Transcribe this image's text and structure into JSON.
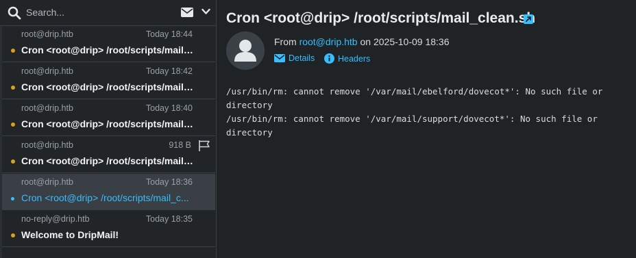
{
  "search": {
    "placeholder": "Search..."
  },
  "messages": [
    {
      "from": "root@drip.htb",
      "date": "Today 18:44",
      "subject": "Cron <root@drip> /root/scripts/mail_c..."
    },
    {
      "from": "root@drip.htb",
      "date": "Today 18:42",
      "subject": "Cron <root@drip> /root/scripts/mail_c..."
    },
    {
      "from": "root@drip.htb",
      "date": "Today 18:40",
      "subject": "Cron <root@drip> /root/scripts/mail_c..."
    },
    {
      "from": "root@drip.htb",
      "date": "918 B",
      "subject": "Cron <root@drip> /root/scripts/mail_c..."
    },
    {
      "from": "root@drip.htb",
      "date": "Today 18:36",
      "subject": "Cron <root@drip> /root/scripts/mail_c..."
    },
    {
      "from": "no-reply@drip.htb",
      "date": "Today 18:35",
      "subject": "Welcome to DripMail!"
    }
  ],
  "view": {
    "subject": "Cron <root@drip> /root/scripts/mail_clean.sh",
    "from_prefix": "From",
    "from_address": "root@drip.htb",
    "date_prefix": "on",
    "date": "2025-10-09 18:36",
    "details_label": "Details",
    "headers_label": "Headers",
    "body": "/usr/bin/rm: cannot remove '/var/mail/ebelford/dovecot*': No such file or\ndirectory\n/usr/bin/rm: cannot remove '/var/mail/support/dovecot*': No such file or\ndirectory"
  },
  "colors": {
    "accent": "#37beff",
    "unread_dot": "#d6a11e",
    "background": "#1f2326",
    "selected_row": "#393f44"
  },
  "icons": [
    "search-icon",
    "envelope-icon",
    "chevron-down-icon",
    "flag-icon",
    "external-link-icon",
    "avatar-icon",
    "envelope-small-icon",
    "info-icon"
  ]
}
